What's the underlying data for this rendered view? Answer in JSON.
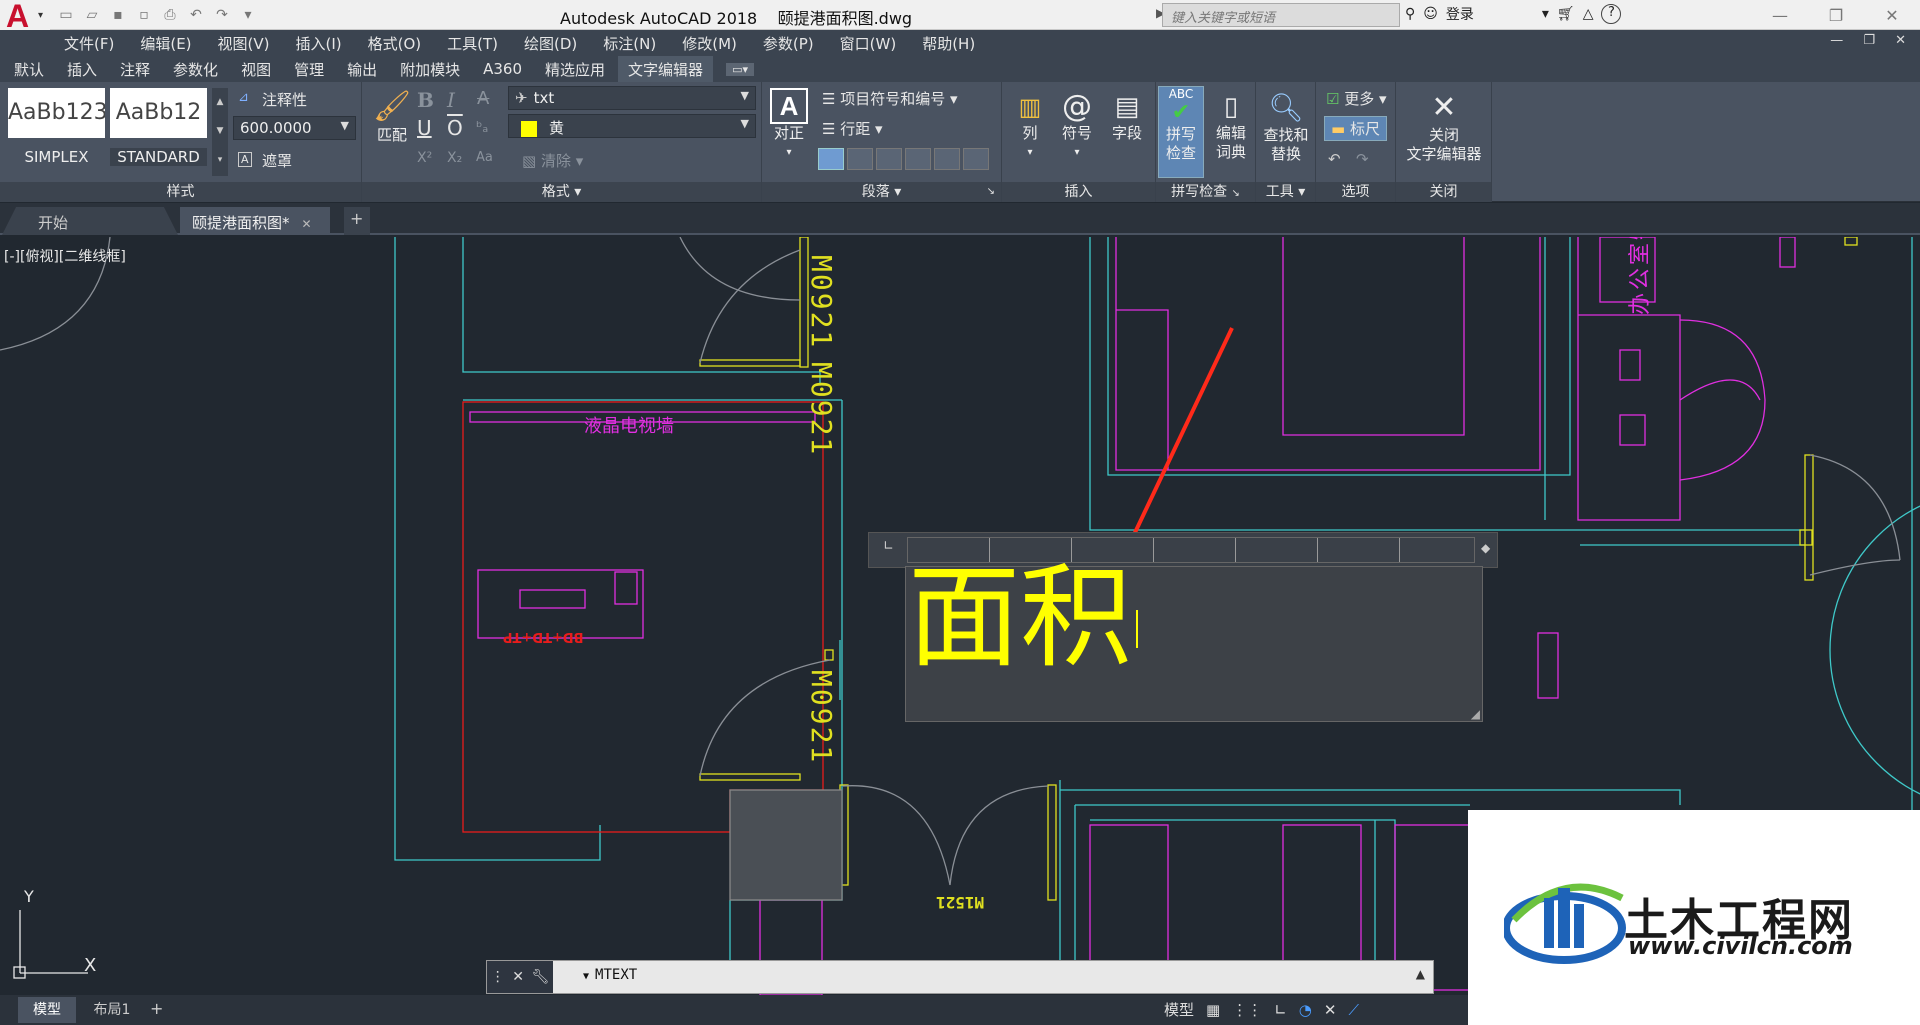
{
  "app": {
    "title": "Autodesk AutoCAD 2018    颐提港面积图.dwg",
    "logo_letter": "A",
    "search_placeholder": "键入关键字或短语",
    "login_label": "登录",
    "help_label": "?"
  },
  "menubar": {
    "items": [
      "文件(F)",
      "编辑(E)",
      "视图(V)",
      "插入(I)",
      "格式(O)",
      "工具(T)",
      "绘图(D)",
      "标注(N)",
      "修改(M)",
      "参数(P)",
      "窗口(W)",
      "帮助(H)"
    ]
  },
  "ribbon_tabs": {
    "items": [
      "默认",
      "插入",
      "注释",
      "参数化",
      "视图",
      "管理",
      "输出",
      "附加模块",
      "A360",
      "精选应用"
    ],
    "active": "文字编辑器"
  },
  "ribbon": {
    "style_panel": {
      "title": "样式",
      "style1_preview": "AaBb123",
      "style1_name": "SIMPLEX",
      "style2_preview": "AaBb12",
      "style2_name": "STANDARD",
      "annotative_label": "注释性",
      "height_value": "600.0000",
      "mask_label": "遮罩"
    },
    "format_panel": {
      "title": "格式",
      "match_label": "匹配",
      "bold": "B",
      "italic": "I",
      "strike": "A",
      "underline": "U",
      "overline": "O",
      "font_value": "txt",
      "color_value": "黄",
      "clear_label": "清除",
      "superscript": "X²",
      "subscript": "X₂",
      "case": "Aa"
    },
    "paragraph_panel": {
      "title": "段落",
      "justify_label": "对正",
      "bullets_label": "项目符号和编号",
      "linespacing_label": "行距"
    },
    "insert_panel": {
      "title": "插入",
      "columns_label": "列",
      "symbol_label": "符号",
      "field_label": "字段"
    },
    "spell_panel": {
      "title": "拼写检查",
      "spell_label": "拼写\n检查",
      "spell_icon": "ABC",
      "dict_label": "编辑\n词典"
    },
    "tools_panel": {
      "title": "工具",
      "find_label": "查找和\n替换"
    },
    "options_panel": {
      "title": "选项",
      "more_label": "更多",
      "ruler_label": "标尺"
    },
    "close_panel": {
      "title": "关闭",
      "close_label": "关闭\n文字编辑器"
    }
  },
  "doc_tabs": {
    "start": "开始",
    "current": "颐提港面积图*"
  },
  "drawing": {
    "view_label": "[-][俯视][二维线框]",
    "door_tag_1": "M0921",
    "door_tag_2": "M0921",
    "door_tag_3": "M0921",
    "door_tag_4": "M1521",
    "tv_wall_label": "液晶电视墙",
    "desk_label": "BD+TD+TP",
    "room_label": "办公室物业",
    "mtext_content": "面积",
    "ucs_x": "X",
    "ucs_y": "Y"
  },
  "command_line": {
    "text": "MTEXT"
  },
  "status_bar": {
    "tab_model": "模型",
    "tab_layout": "布局1",
    "model_label": "模型"
  },
  "watermark": {
    "title": "土木工程网",
    "url": "www.civilcn.com"
  },
  "colors": {
    "background": "#212830",
    "cyan": "#3fc9c9",
    "magenta": "#e02fe0",
    "yellow": "#ffff00",
    "red": "#e81c1c",
    "ribbon": "#4a5361"
  }
}
